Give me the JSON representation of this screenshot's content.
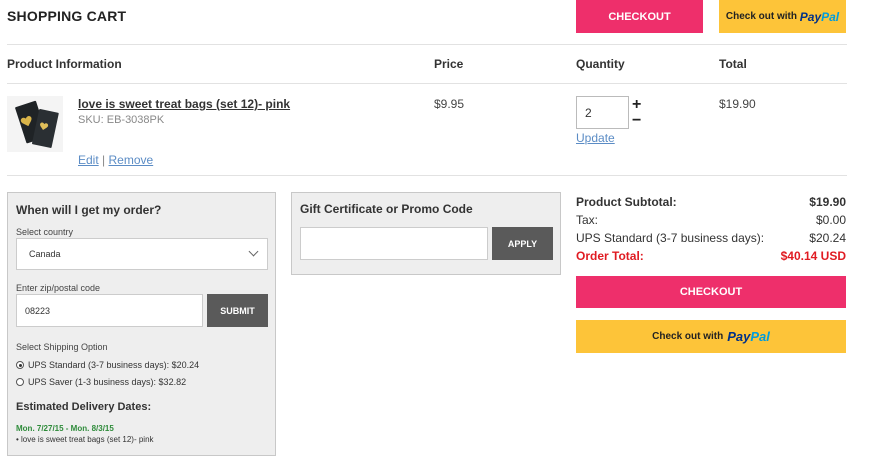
{
  "page": {
    "title": "SHOPPING CART"
  },
  "buttons": {
    "checkout": "CHECKOUT",
    "paypal_prefix": "Check out with",
    "paypal_brand_a": "Pay",
    "paypal_brand_b": "Pal"
  },
  "table": {
    "headers": [
      "Product Information",
      "Price",
      "Quantity",
      "Total"
    ]
  },
  "item": {
    "name": "love is sweet treat bags (set 12)- pink",
    "sku": "SKU: EB-3038PK",
    "edit": "Edit",
    "separator": "|",
    "remove": "Remove",
    "price": "$9.95",
    "quantity": "2",
    "plus": "+",
    "minus": "−",
    "update": "Update",
    "total": "$19.90"
  },
  "delivery": {
    "heading": "When will I get my order?",
    "country_label": "Select country",
    "country_value": "Canada",
    "zip_label": "Enter zip/postal code",
    "zip_value": "08223",
    "submit": "SUBMIT",
    "shipping_label": "Select Shipping Option",
    "options": [
      {
        "label": "UPS Standard (3-7 business days): $20.24",
        "selected": true
      },
      {
        "label": "UPS Saver (1-3 business days): $32.82",
        "selected": false
      }
    ],
    "dates_heading": "Estimated Delivery Dates:",
    "date_range": "Mon. 7/27/15 - Mon. 8/3/15",
    "date_item": "• love is sweet treat bags (set 12)- pink"
  },
  "promo": {
    "heading": "Gift Certificate or Promo Code",
    "input_value": "",
    "apply": "APPLY"
  },
  "summary": {
    "subtotal_label": "Product Subtotal:",
    "subtotal_value": "$19.90",
    "tax_label": "Tax:",
    "tax_value": "$0.00",
    "shipping_label": "UPS Standard (3-7 business days):",
    "shipping_value": "$20.24",
    "total_label": "Order Total:",
    "total_value": "$40.14 USD"
  },
  "colors": {
    "checkout_pink": "#ee2f6b",
    "paypal_yellow": "#fdc439",
    "order_total_red": "#e01b22",
    "delivery_green": "#2e8b3a",
    "link_blue": "#5b8cc5"
  }
}
